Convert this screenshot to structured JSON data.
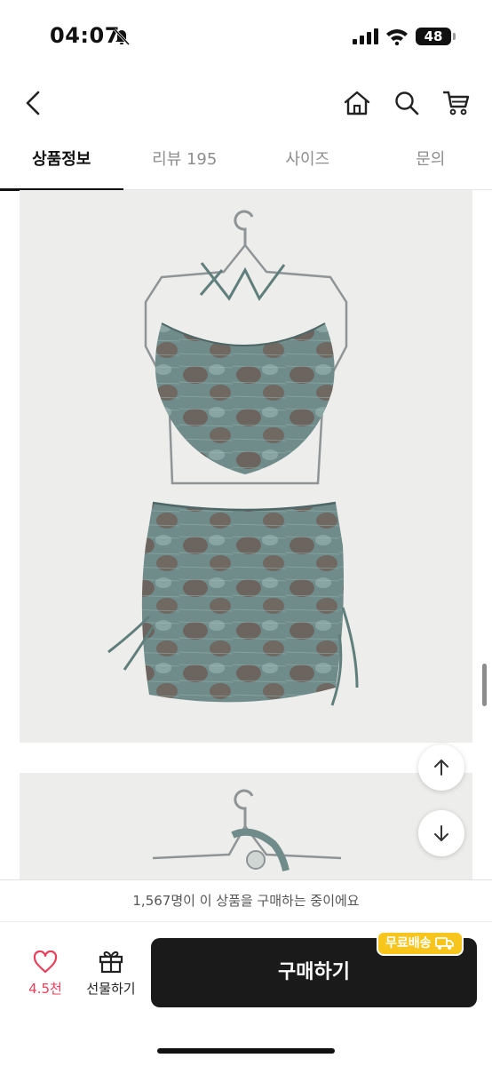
{
  "status": {
    "time": "04:07",
    "battery": "48"
  },
  "header": {
    "back_icon": "chevron-left-icon",
    "home_icon": "home-icon",
    "search_icon": "search-icon",
    "cart_icon": "cart-icon"
  },
  "tabs": [
    {
      "label": "상품정보",
      "active": true
    },
    {
      "label": "리뷰 195",
      "active": false
    },
    {
      "label": "사이즈",
      "active": false
    },
    {
      "label": "문의",
      "active": false
    }
  ],
  "notice": {
    "text": "1,567명이 이 상품을 구매하는 중이에요"
  },
  "bottom": {
    "like_count": "4.5천",
    "gift_label": "선물하기",
    "buy_label": "구매하기",
    "shipping_badge": "무료배송"
  },
  "colors": {
    "like": "#e8405a",
    "badge": "#f7c51b",
    "buy_button": "#1a1a1a",
    "garment": "#6f8c8a"
  }
}
